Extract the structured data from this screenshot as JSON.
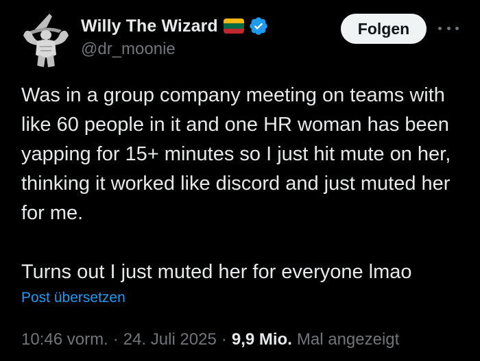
{
  "author": {
    "display_name": "Willy The Wizard",
    "handle": "@dr_moonie",
    "avatar_icon": "wizard-avatar",
    "flag_icon": "lithuania-flag-icon",
    "flag_colors": [
      "#FDB913",
      "#006A44",
      "#C1272D"
    ],
    "verified_icon": "verified-badge-icon",
    "verified_color": "#1d9bf0"
  },
  "actions": {
    "follow_label": "Folgen",
    "more_icon": "more-dots-icon"
  },
  "tweet": {
    "paragraphs": [
      "Was in a group company meeting on teams with like 60 people in it and one HR woman has been yapping for 15+ minutes so I just hit mute on her, thinking it worked like discord and just muted her for me.",
      "Turns out I just muted her for everyone lmao"
    ],
    "translate_label": "Post übersetzen"
  },
  "meta": {
    "time": "10:46 vorm.",
    "separator": "·",
    "date": "24. Juli 2025",
    "views_count": "9,9 Mio.",
    "views_label": "Mal angezeigt"
  },
  "colors": {
    "background": "#000000",
    "primary_text": "#e7e9ea",
    "secondary_text": "#71767b",
    "link": "#1d9bf0",
    "button_bg": "#eff3f4"
  }
}
